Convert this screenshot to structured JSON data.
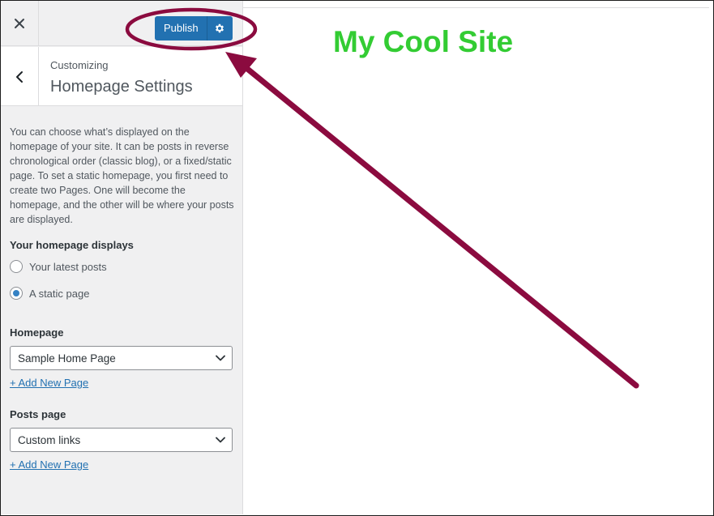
{
  "topbar": {
    "close_icon": "close-icon",
    "publish_label": "Publish",
    "gear_icon": "gear-icon"
  },
  "header": {
    "back_icon": "chevron-left-icon",
    "breadcrumb": "Customizing",
    "title": "Homepage Settings"
  },
  "content": {
    "description": "You can choose what’s displayed on the homepage of your site. It can be posts in reverse chronological order (classic blog), or a fixed/static page. To set a static homepage, you first need to create two Pages. One will become the homepage, and the other will be where your posts are displayed.",
    "homepage_displays_label": "Your homepage displays",
    "options": [
      {
        "label": "Your latest posts",
        "checked": false
      },
      {
        "label": "A static page",
        "checked": true
      }
    ],
    "homepage_label": "Homepage",
    "homepage_value": "Sample Home Page",
    "homepage_add_link": "+ Add New Page",
    "posts_page_label": "Posts page",
    "posts_page_value": "Custom links",
    "posts_page_add_link": "+ Add New Page"
  },
  "preview": {
    "site_title": "My Cool Site"
  },
  "colors": {
    "primary": "#2271b1",
    "site_title": "#33cc33",
    "annotation": "#8b0b3f"
  }
}
